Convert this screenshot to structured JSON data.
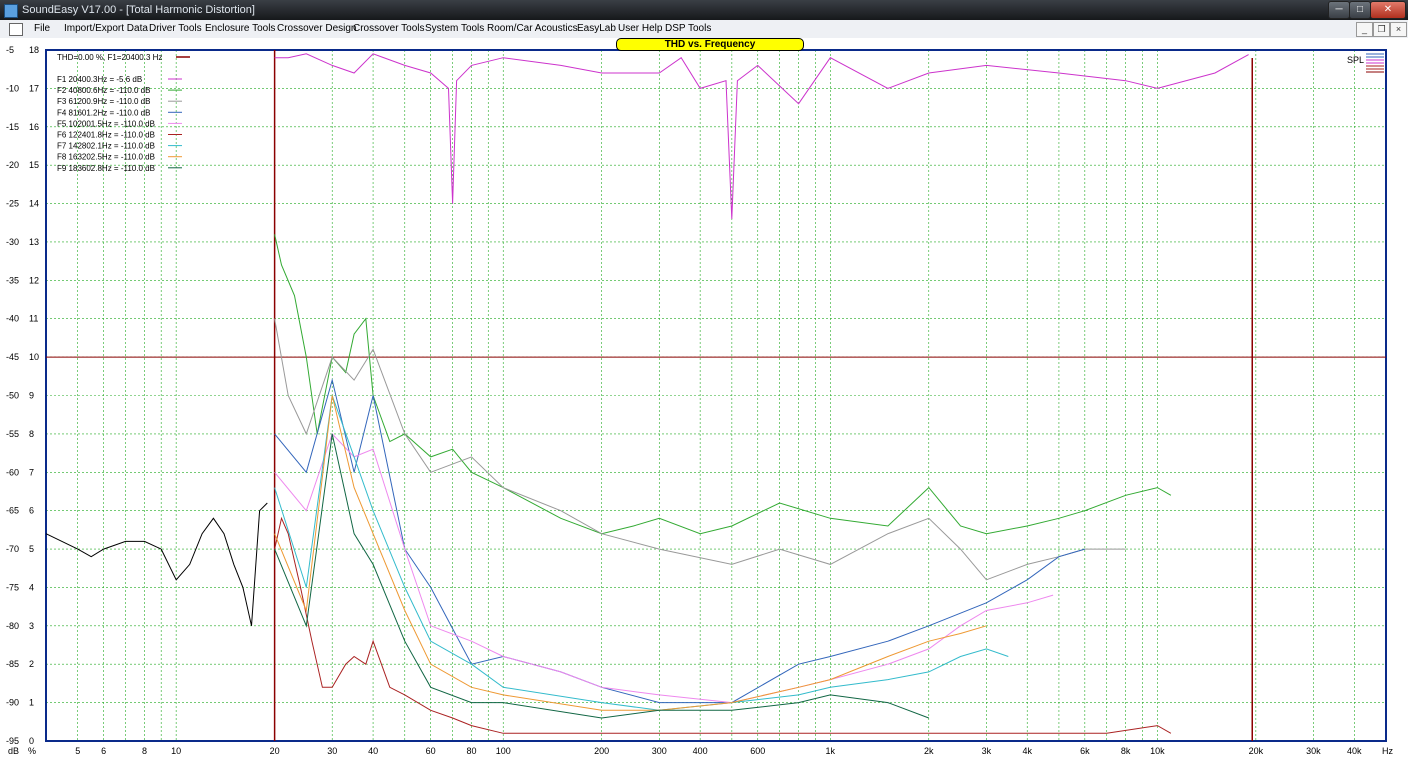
{
  "window": {
    "title": "SoundEasy V17.00 - [Total Harmonic Distortion]",
    "min_glyph": "─",
    "max_glyph": "□",
    "close_glyph": "✕"
  },
  "menu": {
    "items": [
      "File",
      "Import/Export Data",
      "Driver Tools",
      "Enclosure Tools",
      "Crossover Design",
      "Crossover Tools",
      "System Tools",
      "Room/Car Acoustics",
      "EasyLab",
      "User Help",
      "DSP Tools"
    ],
    "mdi_min": "_",
    "mdi_restore": "❐",
    "mdi_close": "×"
  },
  "chart_data": {
    "type": "line",
    "title": "THD vs. Frequency",
    "xlabel": "Hz",
    "y_units_left": "dB",
    "y_units_right": "%",
    "x_scale": "log",
    "xlim": [
      4,
      50000
    ],
    "ylim": [
      -95,
      -5
    ],
    "pct_lim": [
      0,
      18
    ],
    "grid": true,
    "x_ticks": [
      {
        "v": 5,
        "label": "5"
      },
      {
        "v": 6,
        "label": "6"
      },
      {
        "v": 8,
        "label": "8"
      },
      {
        "v": 10,
        "label": "10"
      },
      {
        "v": 20,
        "label": "20"
      },
      {
        "v": 30,
        "label": "30"
      },
      {
        "v": 40,
        "label": "40"
      },
      {
        "v": 60,
        "label": "60"
      },
      {
        "v": 80,
        "label": "80"
      },
      {
        "v": 100,
        "label": "100"
      },
      {
        "v": 200,
        "label": "200"
      },
      {
        "v": 300,
        "label": "300"
      },
      {
        "v": 400,
        "label": "400"
      },
      {
        "v": 600,
        "label": "600"
      },
      {
        "v": 1000,
        "label": "1k"
      },
      {
        "v": 2000,
        "label": "2k"
      },
      {
        "v": 3000,
        "label": "3k"
      },
      {
        "v": 4000,
        "label": "4k"
      },
      {
        "v": 6000,
        "label": "6k"
      },
      {
        "v": 8000,
        "label": "8k"
      },
      {
        "v": 10000,
        "label": "10k"
      },
      {
        "v": 20000,
        "label": "20k"
      },
      {
        "v": 30000,
        "label": "30k"
      },
      {
        "v": 40000,
        "label": "40k"
      }
    ],
    "y_ticks": [
      {
        "db": "-5",
        "pct": "18"
      },
      {
        "db": "-10",
        "pct": "17"
      },
      {
        "db": "-15",
        "pct": "16"
      },
      {
        "db": "-20",
        "pct": "15"
      },
      {
        "db": "-25",
        "pct": "14"
      },
      {
        "db": "-30",
        "pct": "13"
      },
      {
        "db": "-35",
        "pct": "12"
      },
      {
        "db": "-40",
        "pct": "11"
      },
      {
        "db": "-45",
        "pct": "10"
      },
      {
        "db": "-50",
        "pct": "9"
      },
      {
        "db": "-55",
        "pct": "8"
      },
      {
        "db": "-60",
        "pct": "7"
      },
      {
        "db": "-65",
        "pct": "6"
      },
      {
        "db": "-70",
        "pct": "5"
      },
      {
        "db": "-75",
        "pct": "4"
      },
      {
        "db": "-80",
        "pct": "3"
      },
      {
        "db": "-85",
        "pct": "2"
      },
      {
        "db": "-90",
        "pct": "1"
      },
      {
        "db": "-95",
        "pct": "0"
      }
    ],
    "legend_header": "THD=0.00 %, F1=20400.3 Hz",
    "thd_marker_db": -45,
    "legend": [
      {
        "label": "F1 20400.3Hz = -5.6 dB",
        "color": "#cc33cc"
      },
      {
        "label": "F2 40800.6Hz = -110.0 dB",
        "color": "#33aa33"
      },
      {
        "label": "F3 61200.9Hz = -110.0 dB",
        "color": "#999999"
      },
      {
        "label": "F4 81601.2Hz = -110.0 dB",
        "color": "#3366bb"
      },
      {
        "label": "F5 102001.5Hz = -110.0 dB",
        "color": "#ee88ee"
      },
      {
        "label": "F6 122401.8Hz = -110.0 dB",
        "color": "#aa2222"
      },
      {
        "label": "F7 142802.1Hz = -110.0 dB",
        "color": "#33bbcc"
      },
      {
        "label": "F8 163202.5Hz = -110.0 dB",
        "color": "#ee9933"
      },
      {
        "label": "F9 183602.8Hz = -110.0 dB",
        "color": "#116644"
      }
    ],
    "spl_label": "SPL",
    "series": [
      {
        "role": "f1",
        "color": "#cc33cc",
        "x": [
          20,
          22,
          25,
          30,
          35,
          40,
          50,
          60,
          68,
          70,
          72,
          80,
          100,
          150,
          200,
          300,
          350,
          400,
          480,
          500,
          520,
          600,
          800,
          1000,
          1500,
          2000,
          3000,
          5000,
          8000,
          10000,
          15000,
          19000
        ],
        "y": [
          -6,
          -6,
          -5.5,
          -7,
          -8,
          -5.5,
          -7,
          -8,
          -10,
          -25,
          -9,
          -7,
          -6,
          -7,
          -8,
          -8,
          -6,
          -10,
          -9,
          -27,
          -9,
          -7,
          -12,
          -6,
          -10,
          -8,
          -7,
          -8,
          -9,
          -10,
          -8,
          -5.6
        ]
      },
      {
        "role": "f2",
        "color": "#33aa33",
        "x": [
          20,
          21,
          23,
          25,
          27,
          30,
          33,
          35,
          38,
          40,
          45,
          50,
          60,
          70,
          80,
          100,
          150,
          200,
          250,
          300,
          400,
          500,
          700,
          1000,
          1500,
          2000,
          2500,
          3000,
          4000,
          5000,
          6000,
          8000,
          10000,
          11000
        ],
        "y": [
          -29,
          -33,
          -37,
          -45,
          -55,
          -45,
          -47,
          -42,
          -40,
          -50,
          -56,
          -55,
          -58,
          -57,
          -60,
          -62,
          -66,
          -68,
          -67,
          -66,
          -68,
          -67,
          -64,
          -66,
          -67,
          -62,
          -67,
          -68,
          -67,
          -66,
          -65,
          -63,
          -62,
          -63
        ]
      },
      {
        "role": "f3",
        "color": "#999999",
        "x": [
          20,
          22,
          25,
          30,
          35,
          40,
          50,
          60,
          80,
          100,
          150,
          200,
          300,
          500,
          700,
          1000,
          1500,
          2000,
          2500,
          3000,
          4000,
          5000,
          6000,
          7000,
          8000
        ],
        "y": [
          -40,
          -50,
          -55,
          -45,
          -48,
          -44,
          -55,
          -60,
          -58,
          -62,
          -65,
          -68,
          -70,
          -72,
          -70,
          -72,
          -68,
          -66,
          -70,
          -74,
          -72,
          -71,
          -70,
          -70,
          -70
        ]
      },
      {
        "role": "f4",
        "color": "#3366bb",
        "x": [
          20,
          25,
          30,
          35,
          40,
          50,
          60,
          80,
          100,
          150,
          200,
          300,
          500,
          800,
          1000,
          1500,
          2000,
          3000,
          4000,
          5000,
          6000
        ],
        "y": [
          -55,
          -60,
          -48,
          -60,
          -50,
          -70,
          -75,
          -85,
          -84,
          -86,
          -88,
          -90,
          -90,
          -85,
          -84,
          -82,
          -80,
          -77,
          -74,
          -71,
          -70
        ]
      },
      {
        "role": "f5",
        "color": "#ee88ee",
        "x": [
          20,
          25,
          30,
          35,
          40,
          50,
          60,
          80,
          100,
          150,
          200,
          300,
          500,
          800,
          1000,
          1500,
          2000,
          2500,
          3000,
          4000,
          4800
        ],
        "y": [
          -60,
          -65,
          -55,
          -58,
          -57,
          -70,
          -80,
          -82,
          -84,
          -86,
          -88,
          -89,
          -90,
          -88,
          -87,
          -85,
          -83,
          -80,
          -78,
          -77,
          -76
        ]
      },
      {
        "role": "f6",
        "color": "#aa2222",
        "x": [
          20,
          21,
          22,
          24,
          26,
          28,
          30,
          33,
          35,
          38,
          40,
          45,
          50,
          60,
          70,
          80,
          100,
          150,
          200,
          300,
          500,
          800,
          1000,
          2000,
          3000,
          4000,
          5000,
          7000,
          10000,
          11000
        ],
        "y": [
          -70,
          -66,
          -68,
          -75,
          -82,
          -88,
          -88,
          -85,
          -84,
          -85,
          -82,
          -88,
          -89,
          -91,
          -92,
          -93,
          -94,
          -94,
          -94,
          -94,
          -94,
          -94,
          -94,
          -94,
          -94,
          -94,
          -94,
          -94,
          -93,
          -94
        ]
      },
      {
        "role": "f7",
        "color": "#33bbcc",
        "x": [
          20,
          25,
          30,
          35,
          40,
          50,
          60,
          80,
          100,
          200,
          300,
          500,
          800,
          1000,
          1500,
          2000,
          2500,
          3000,
          3500
        ],
        "y": [
          -62,
          -75,
          -50,
          -58,
          -65,
          -75,
          -82,
          -85,
          -88,
          -90,
          -91,
          -90,
          -89,
          -88,
          -87,
          -86,
          -84,
          -83,
          -84
        ]
      },
      {
        "role": "f8",
        "color": "#ee9933",
        "x": [
          20,
          25,
          30,
          35,
          40,
          50,
          60,
          80,
          100,
          200,
          300,
          500,
          800,
          1000,
          1500,
          2000,
          2500,
          3000
        ],
        "y": [
          -68,
          -78,
          -50,
          -62,
          -68,
          -78,
          -85,
          -88,
          -89,
          -91,
          -91,
          -90,
          -88,
          -87,
          -84,
          -82,
          -81,
          -80
        ]
      },
      {
        "role": "f9",
        "color": "#116644",
        "x": [
          20,
          25,
          30,
          35,
          40,
          50,
          60,
          80,
          100,
          200,
          300,
          500,
          800,
          1000,
          1500,
          2000
        ],
        "y": [
          -70,
          -80,
          -55,
          -68,
          -72,
          -82,
          -88,
          -90,
          -90,
          -92,
          -91,
          -91,
          -90,
          -89,
          -90,
          -92
        ]
      },
      {
        "role": "thd-low",
        "color": "#000000",
        "x": [
          4,
          5,
          5.5,
          6,
          7,
          8,
          9,
          10,
          11,
          12,
          13,
          14,
          15,
          16,
          17,
          18,
          19
        ],
        "y": [
          -68,
          -70,
          -71,
          -70,
          -69,
          -69,
          -70,
          -74,
          -72,
          -68,
          -66,
          -68,
          -72,
          -75,
          -80,
          -65,
          -64
        ]
      }
    ]
  }
}
